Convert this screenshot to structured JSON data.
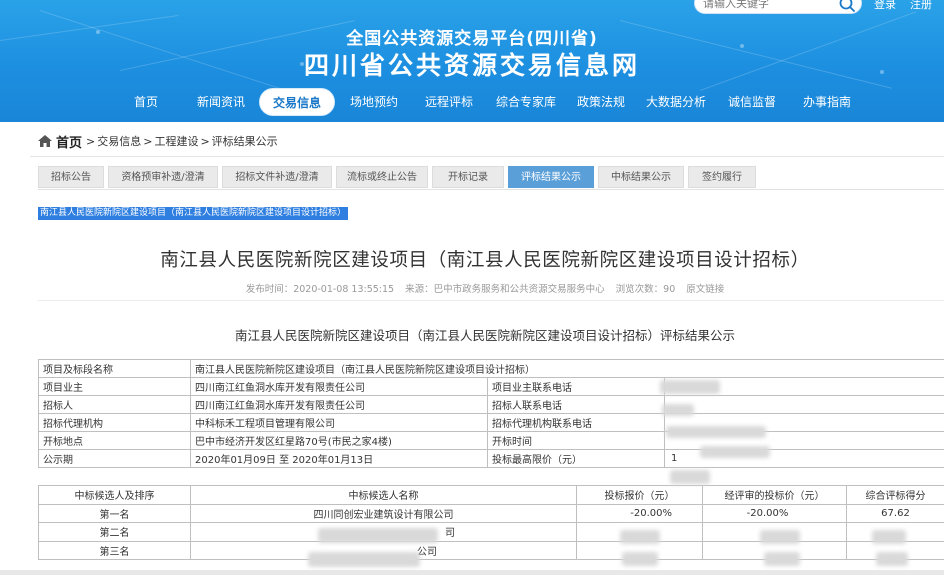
{
  "header": {
    "search": {
      "placeholder": "请输入关键字"
    },
    "login_label": "登录",
    "register_label": "注册",
    "platform_title": "全国公共资源交易平台(四川省)",
    "site_title": "四川省公共资源交易信息网"
  },
  "nav": {
    "items": [
      {
        "label": "首页"
      },
      {
        "label": "新闻资讯"
      },
      {
        "label": "交易信息"
      },
      {
        "label": "场地预约"
      },
      {
        "label": "远程评标"
      },
      {
        "label": "综合专家库"
      },
      {
        "label": "政策法规"
      },
      {
        "label": "大数据分析"
      },
      {
        "label": "诚信监督"
      },
      {
        "label": "办事指南"
      }
    ],
    "active_index": 2
  },
  "breadcrumb": {
    "home": "首页",
    "items": [
      "交易信息",
      "工程建设",
      "评标结果公示"
    ]
  },
  "sub_tabs": {
    "items": [
      {
        "label": "招标公告"
      },
      {
        "label": "资格预审补遗/澄清"
      },
      {
        "label": "招标文件补遗/澄清"
      },
      {
        "label": "流标或终止公告"
      },
      {
        "label": "开标记录"
      },
      {
        "label": "评标结果公示"
      },
      {
        "label": "中标结果公示"
      },
      {
        "label": "签约履行"
      }
    ],
    "active_index": 5
  },
  "selected_title": "南江县人民医院新院区建设项目（南江县人民医院新院区建设项目设计招标）",
  "article": {
    "title": "南江县人民医院新院区建设项目（南江县人民医院新院区建设项目设计招标）",
    "meta": {
      "publish_time": "发布时间：2020-01-08 13:55:15",
      "source": "来源：巴中市政务服务和公共资源交易服务中心",
      "views": "浏览次数：90",
      "original_link": "原文链接"
    },
    "content_heading": "南江县人民医院新院区建设项目（南江县人民医院新院区建设项目设计招标）评标结果公示"
  },
  "info_table": {
    "project_label": "项目及标段名称",
    "project_value": "南江县人民医院新院区建设项目（南江县人民医院新院区建设项目设计招标）",
    "rows": [
      {
        "l1": "项目业主",
        "v1": "四川南江红鱼洞水库开发有限责任公司",
        "l2": "项目业主联系电话",
        "v2": ""
      },
      {
        "l1": "招标人",
        "v1": "四川南江红鱼洞水库开发有限责任公司",
        "l2": "招标人联系电话",
        "v2": ""
      },
      {
        "l1": "招标代理机构",
        "v1": "中科标禾工程项目管理有限公司",
        "l2": "招标代理机构联系电话",
        "v2": ""
      },
      {
        "l1": "开标地点",
        "v1": "巴中市经济开发区红星路70号(市民之家4楼)",
        "l2": "开标时间",
        "v2": ""
      },
      {
        "l1": "公示期",
        "v1": "2020年01月09日 至 2020年01月13日",
        "l2": "投标最高限价（元）",
        "v2": "1"
      }
    ]
  },
  "bidder_table": {
    "headers": [
      "中标候选人及排序",
      "中标候选人名称",
      "投标报价（元）",
      "经评审的投标价（元）",
      "综合评标得分"
    ],
    "rows": [
      {
        "rank": "第一名",
        "name": "四川同创宏业建筑设计有限公司",
        "bid": "-20.00%",
        "reviewed": "-20.00%",
        "score": "67.62"
      },
      {
        "rank": "第二名",
        "name": "司",
        "bid": "",
        "reviewed": "",
        "score": ""
      },
      {
        "rank": "第三名",
        "name": "公司",
        "bid": "",
        "reviewed": "",
        "score": ""
      }
    ]
  }
}
